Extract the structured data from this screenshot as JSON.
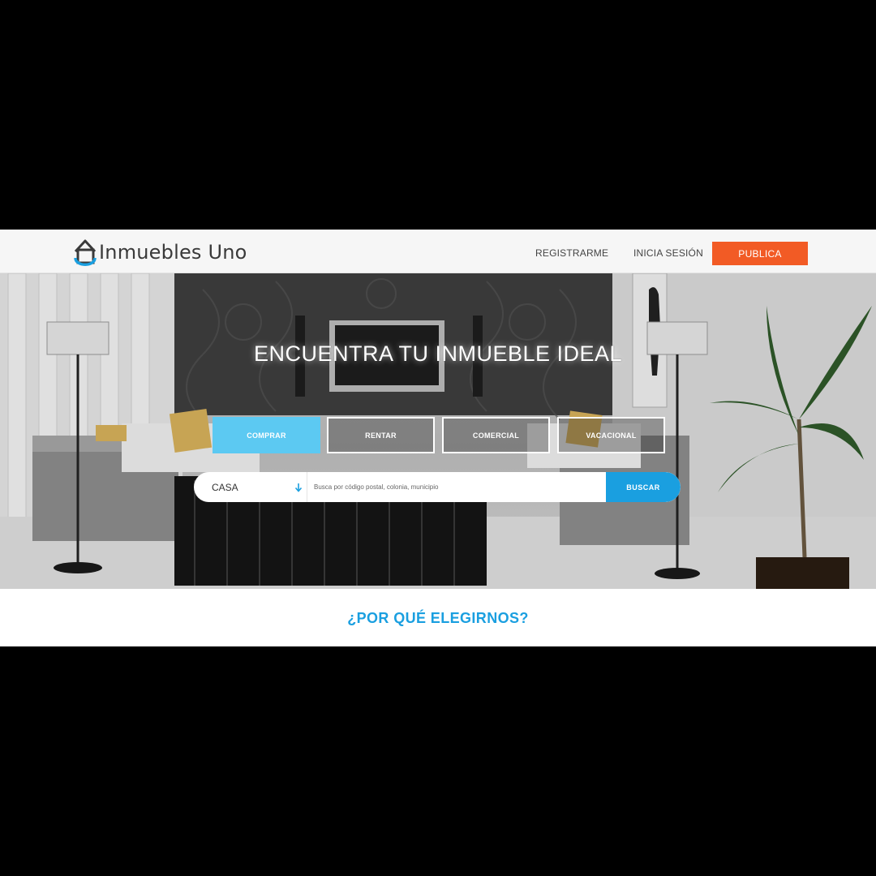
{
  "header": {
    "logo_text": "Inmuebles Uno",
    "nav": {
      "register": "REGISTRARME",
      "login": "INICIA SESIÓN",
      "publish": "PUBLICA"
    }
  },
  "hero": {
    "title": "ENCUENTRA TU  INMUEBLE IDEAL",
    "tabs": [
      "COMPRAR",
      "RENTAR",
      "COMERCIAL",
      "VACACIONAL"
    ],
    "active_tab": "COMPRAR",
    "search": {
      "property_type": "CASA",
      "placeholder": "Busca por código postal, colonia, municipio",
      "button_label": "BUSCAR"
    }
  },
  "section": {
    "title": "¿POR QUÉ ELEGIRNOS?"
  },
  "icons": {
    "logo": "house-pin-icon",
    "select_arrow": "arrow-down-icon"
  },
  "colors": {
    "accent": "#1a9fe0",
    "publish_button": "#f25b25",
    "active_tab": "#5cc9f2",
    "background": "#000000"
  }
}
